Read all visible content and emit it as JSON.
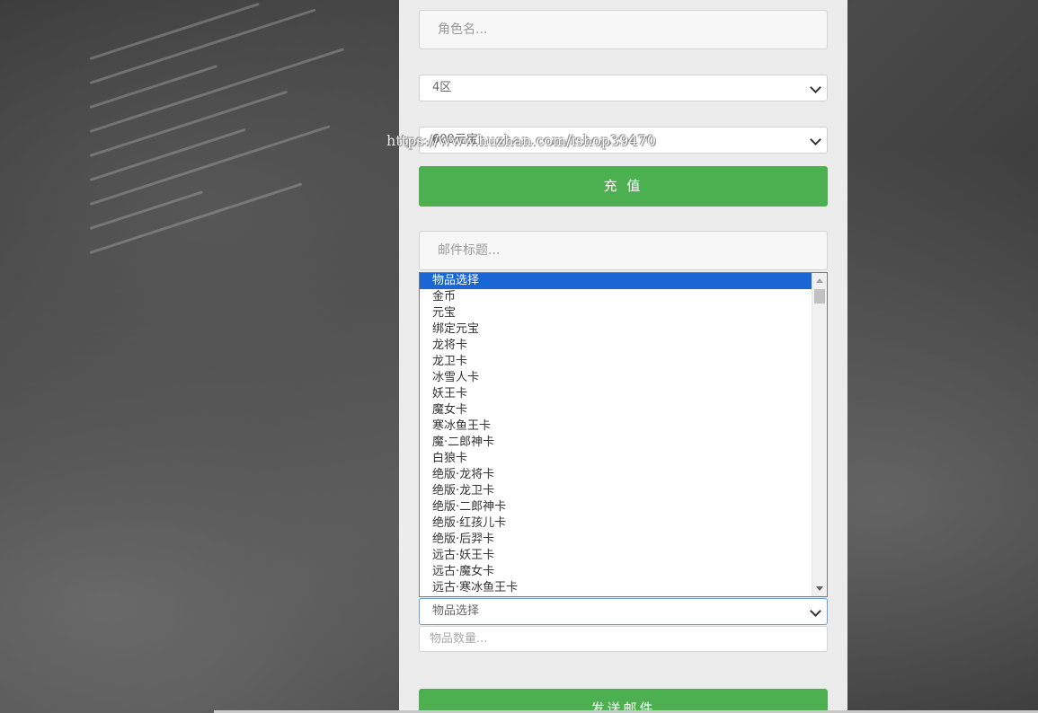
{
  "recharge": {
    "role_placeholder": "角色名...",
    "server_selected": "4区",
    "amount_selected": "600元宝",
    "submit_label": "充 值"
  },
  "watermark": "https://www.huzhan.com/ishop39470",
  "mail": {
    "title_placeholder": "邮件标题...",
    "item_select_value": "物品选择",
    "quantity_placeholder": "物品数量...",
    "send_label": "发送邮件"
  },
  "item_options": [
    "物品选择",
    "金币",
    "元宝",
    "绑定元宝",
    "龙将卡",
    "龙卫卡",
    "冰雪人卡",
    "妖王卡",
    "魔女卡",
    "寒冰鱼王卡",
    "魔·二郎神卡",
    "白狼卡",
    "绝版·龙将卡",
    "绝版·龙卫卡",
    "绝版·二郎神卡",
    "绝版·红孩儿卡",
    "绝版·后羿卡",
    "远古·妖王卡",
    "远古·魔女卡",
    "远古·寒冰鱼王卡"
  ],
  "colors": {
    "button_green": "#4caf50",
    "selected_option": "#1a66d4"
  }
}
